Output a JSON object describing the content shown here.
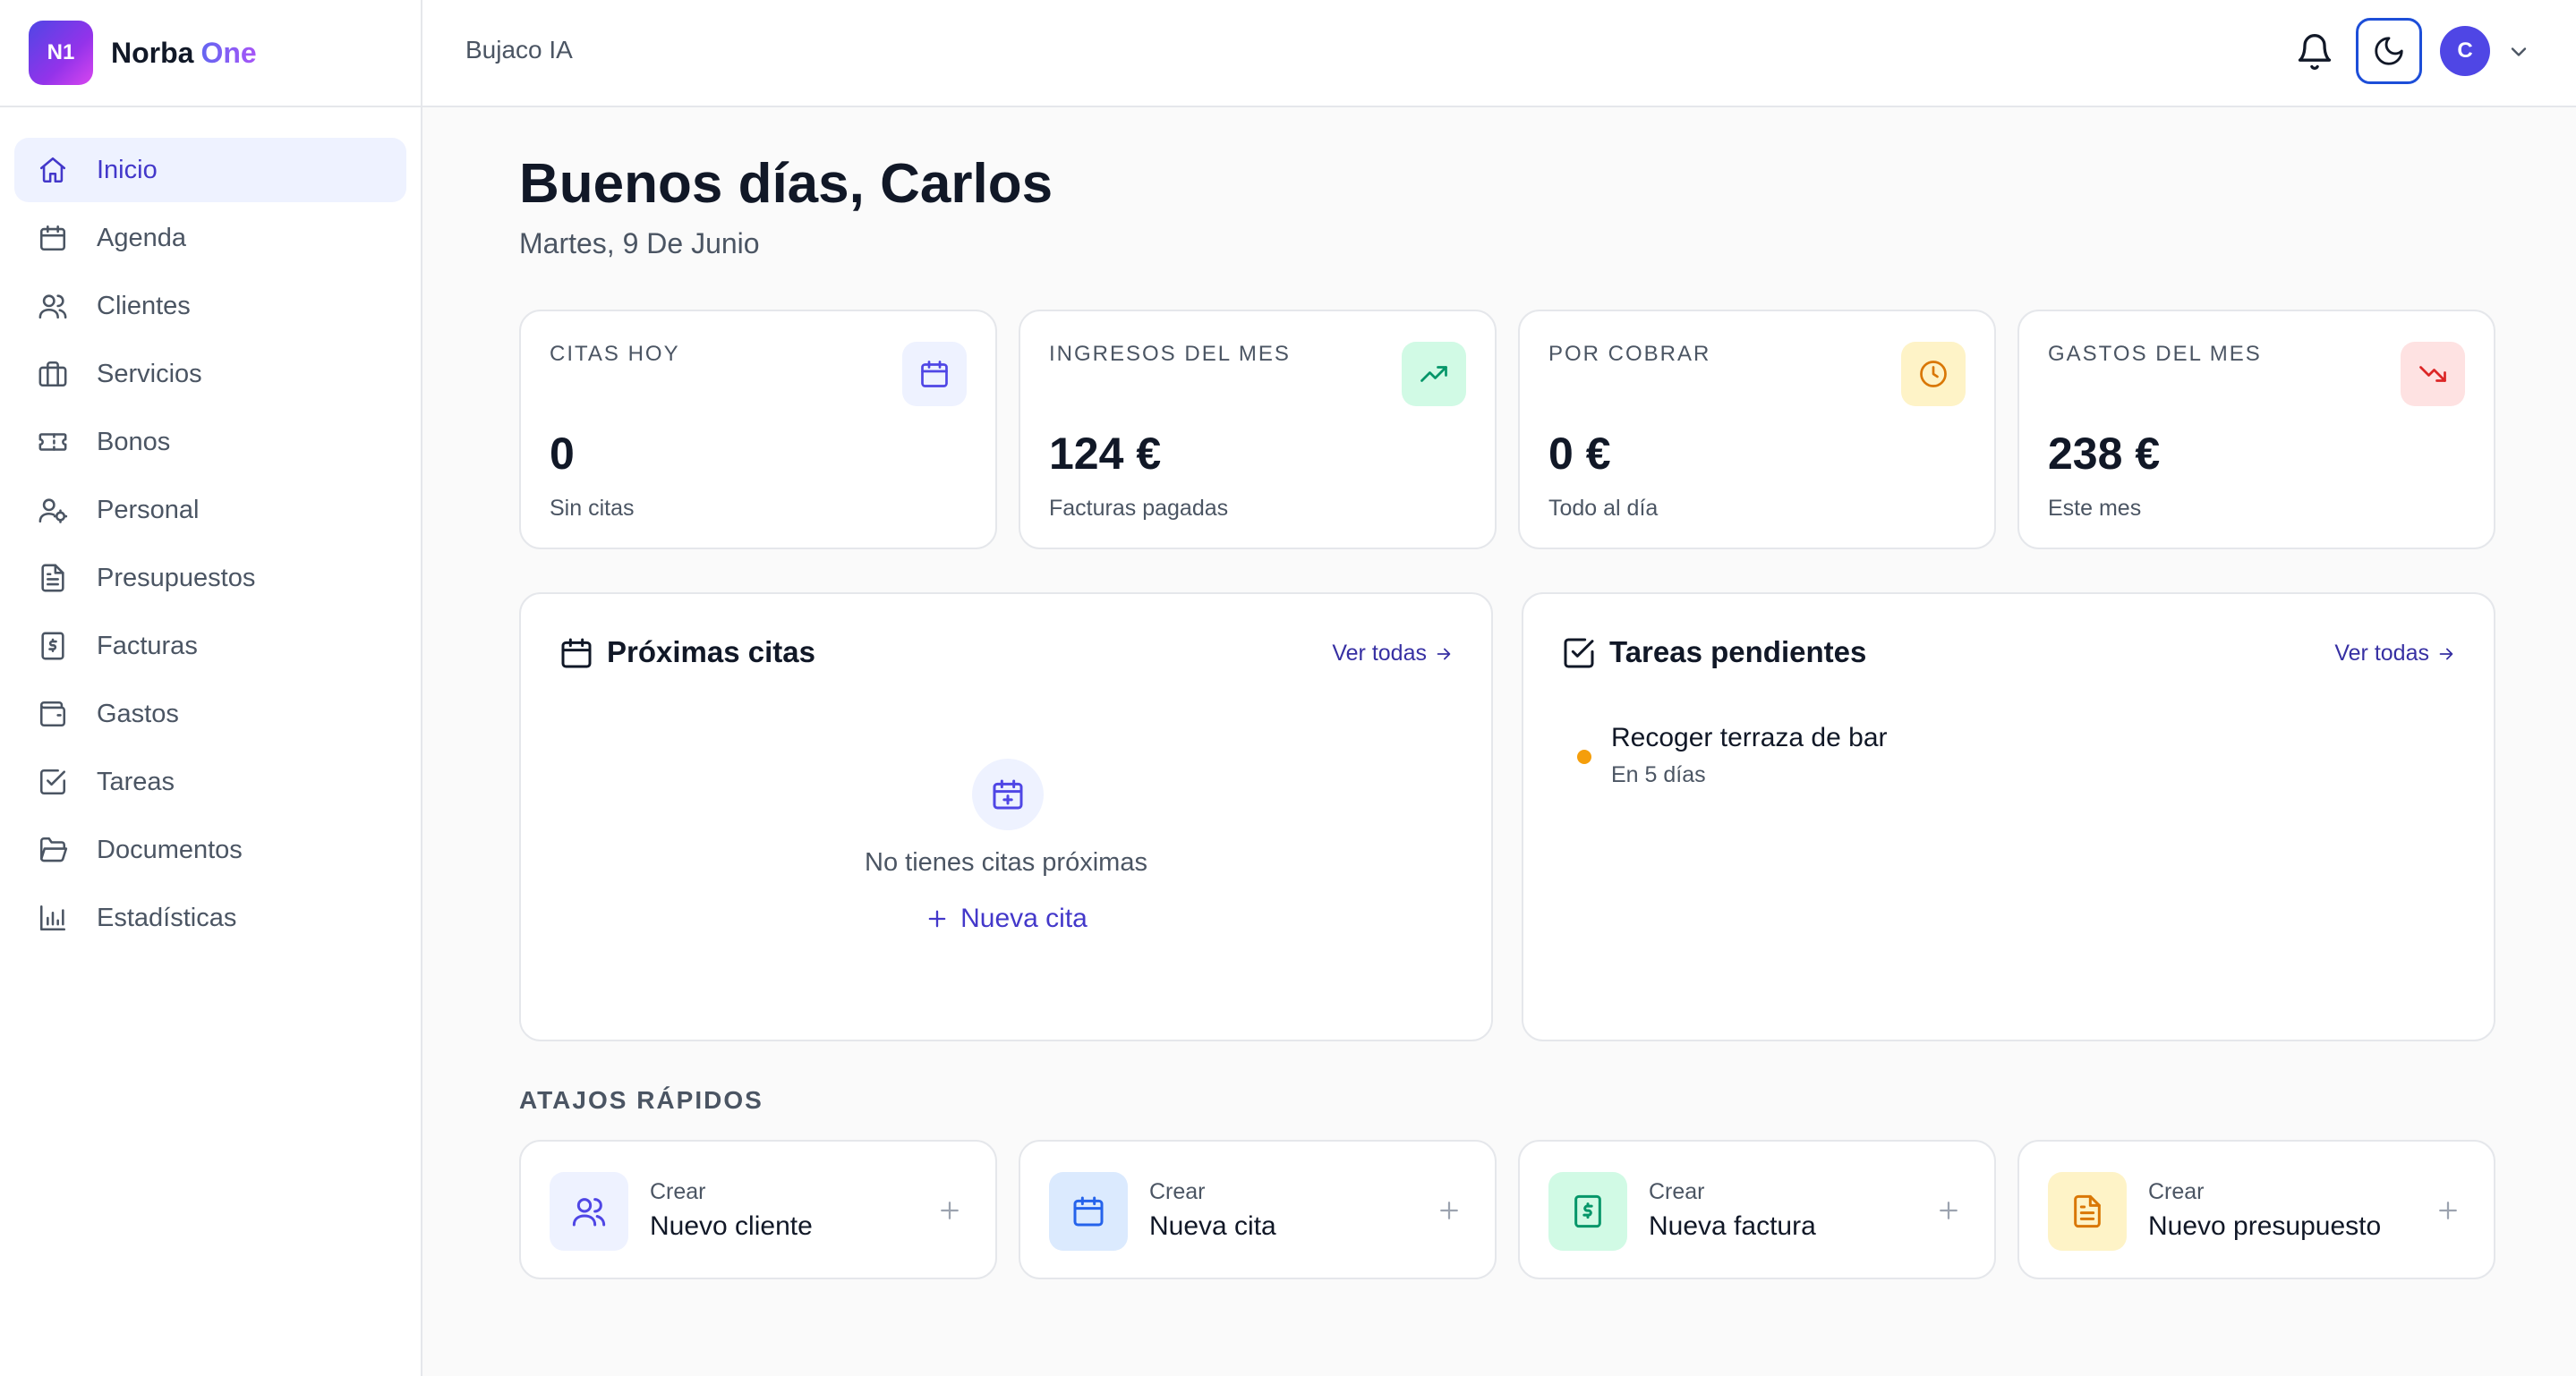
{
  "brand": {
    "logo": "N1",
    "name": "Norba",
    "accent": "One"
  },
  "topbar": {
    "workspace": "Bujaco IA",
    "avatar_initial": "C"
  },
  "sidebar": {
    "items": [
      {
        "label": "Inicio",
        "icon": "home-icon",
        "active": true
      },
      {
        "label": "Agenda",
        "icon": "calendar-icon"
      },
      {
        "label": "Clientes",
        "icon": "users-icon"
      },
      {
        "label": "Servicios",
        "icon": "briefcase-icon"
      },
      {
        "label": "Bonos",
        "icon": "ticket-icon"
      },
      {
        "label": "Personal",
        "icon": "user-cog-icon"
      },
      {
        "label": "Presupuestos",
        "icon": "document-icon"
      },
      {
        "label": "Facturas",
        "icon": "receipt-icon"
      },
      {
        "label": "Gastos",
        "icon": "wallet-icon"
      },
      {
        "label": "Tareas",
        "icon": "check-square-icon"
      },
      {
        "label": "Documentos",
        "icon": "folder-icon"
      },
      {
        "label": "Estadísticas",
        "icon": "bar-chart-icon"
      }
    ]
  },
  "main": {
    "greeting": "Buenos días, Carlos",
    "date": "Martes, 9 De Junio",
    "stats": [
      {
        "label": "CITAS HOY",
        "value": "0",
        "sub": "Sin citas",
        "icon": "calendar-icon",
        "color": "#4f46e5",
        "bg": "#eef2ff"
      },
      {
        "label": "INGRESOS DEL MES",
        "value": "124 €",
        "sub": "Facturas pagadas",
        "icon": "trending-up-icon",
        "color": "#059669",
        "bg": "#d1fae5"
      },
      {
        "label": "POR COBRAR",
        "value": "0 €",
        "sub": "Todo al día",
        "icon": "clock-icon",
        "color": "#d97706",
        "bg": "#fef3c7"
      },
      {
        "label": "GASTOS DEL MES",
        "value": "238 €",
        "sub": "Este mes",
        "icon": "trending-down-icon",
        "color": "#dc2626",
        "bg": "#fee2e2"
      }
    ],
    "appointments": {
      "title": "Próximas citas",
      "view_all": "Ver todas",
      "empty_text": "No tienes citas próximas",
      "new_label": "Nueva cita"
    },
    "tasks": {
      "title": "Tareas pendientes",
      "view_all": "Ver todas",
      "items": [
        {
          "title": "Recoger terraza de bar",
          "due": "En 5 días"
        }
      ]
    },
    "shortcuts_title": "ATAJOS RÁPIDOS",
    "shortcuts": [
      {
        "kicker": "Crear",
        "label": "Nuevo cliente",
        "icon": "users-icon",
        "color": "#4f46e5",
        "bg": "#eef2ff"
      },
      {
        "kicker": "Crear",
        "label": "Nueva cita",
        "icon": "calendar-icon",
        "color": "#2563eb",
        "bg": "#dbeafe"
      },
      {
        "kicker": "Crear",
        "label": "Nueva factura",
        "icon": "receipt-icon",
        "color": "#059669",
        "bg": "#d1fae5"
      },
      {
        "kicker": "Crear",
        "label": "Nuevo presupuesto",
        "icon": "document-icon",
        "color": "#d97706",
        "bg": "#fef3c7"
      }
    ]
  }
}
